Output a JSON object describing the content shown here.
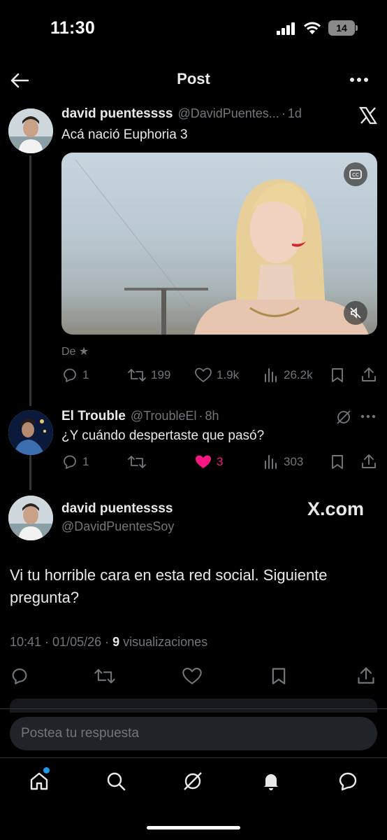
{
  "status_bar": {
    "time": "11:30",
    "battery": "14"
  },
  "header": {
    "title": "Post"
  },
  "tweet1": {
    "name": "david puentessss",
    "handle": "@DavidPuentes...",
    "time": "1d",
    "text": "Acá nació Euphoria 3",
    "source": "De ★",
    "replies": "1",
    "retweets": "199",
    "likes": "1.9k",
    "views": "26.2k"
  },
  "reply1": {
    "name": "El Trouble",
    "handle": "@TroubleEl",
    "time": "8h",
    "text": "¿Y cuándo despertaste que pasó?",
    "replies": "1",
    "retweets": "",
    "likes": "3",
    "views": "303"
  },
  "main_tweet": {
    "name": "david puentessss",
    "handle": "@DavidPuentesSoy",
    "brand": "X.com",
    "text": "Vi tu horrible cara en esta red social. Siguiente pregunta?",
    "timestamp": "10:41 · 01/05/26 · ",
    "views_count": "9",
    "views_label": " visualizaciones"
  },
  "composer": {
    "placeholder": "Postea tu respuesta"
  },
  "colors": {
    "like_active": "#f91880",
    "accent": "#1d9bf0"
  },
  "icons": [
    "back-arrow-icon",
    "more-icon",
    "x-logo-icon",
    "cc-icon",
    "mute-icon",
    "reply-icon",
    "retweet-icon",
    "like-icon",
    "views-icon",
    "bookmark-icon",
    "share-icon",
    "grok-icon",
    "home-icon",
    "search-icon",
    "bell-icon",
    "messages-icon"
  ]
}
